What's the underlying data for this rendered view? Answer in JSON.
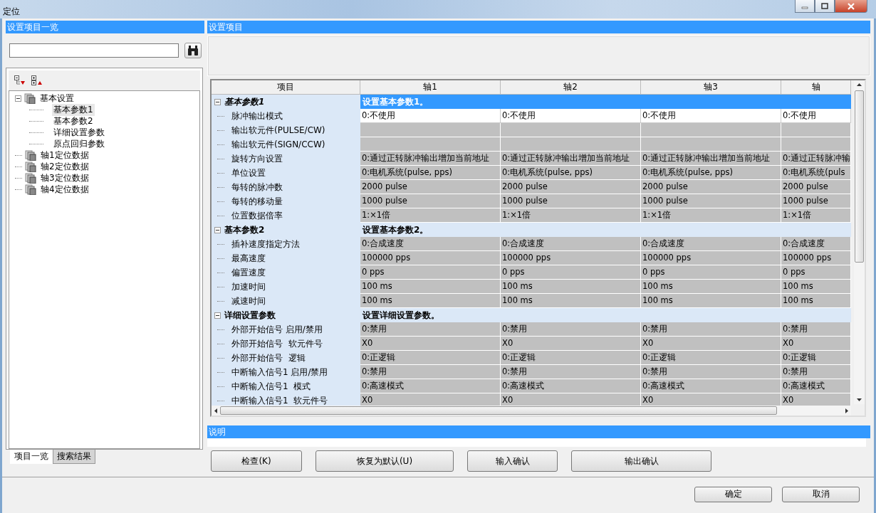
{
  "window": {
    "title": "定位"
  },
  "left_panel": {
    "title": "设置项目一览",
    "tree": [
      {
        "label": "基本设置",
        "expanded": true,
        "selected": false,
        "children": [
          {
            "label": "基本参数1",
            "selected": true
          },
          {
            "label": "基本参数2",
            "selected": false
          },
          {
            "label": "详细设置参数",
            "selected": false
          },
          {
            "label": "原点回归参数",
            "selected": false
          }
        ]
      },
      {
        "label": "轴1定位数据",
        "selected": false
      },
      {
        "label": "轴2定位数据",
        "selected": false
      },
      {
        "label": "轴3定位数据",
        "selected": false
      },
      {
        "label": "轴4定位数据",
        "selected": false
      }
    ],
    "tabs": [
      {
        "label": "项目一览",
        "selected": true
      },
      {
        "label": "搜索结果",
        "selected": false
      }
    ]
  },
  "right_panel": {
    "title": "设置项目",
    "table": {
      "columns": [
        "项目",
        "轴1",
        "轴2",
        "轴3",
        "轴"
      ],
      "groups": [
        {
          "label": "基本参数1",
          "description": "设置基本参数1。",
          "expanded": true,
          "selected": true,
          "rows": [
            {
              "label": "脉冲输出模式",
              "editable": true,
              "values": [
                "0:不使用",
                "0:不使用",
                "0:不使用",
                "0:不使用"
              ]
            },
            {
              "label": "输出软元件(PULSE/CW)",
              "editable": false,
              "values": []
            },
            {
              "label": "输出软元件(SIGN/CCW)",
              "editable": false,
              "values": []
            },
            {
              "label": "旋转方向设置",
              "editable": false,
              "values": [
                "0:通过正转脉冲输出增加当前地址",
                "0:通过正转脉冲输出增加当前地址",
                "0:通过正转脉冲输出增加当前地址",
                "0:通过正转脉冲输"
              ]
            },
            {
              "label": "单位设置",
              "editable": false,
              "values": [
                "0:电机系统(pulse, pps)",
                "0:电机系统(pulse, pps)",
                "0:电机系统(pulse, pps)",
                "0:电机系统(puls"
              ]
            },
            {
              "label": "每转的脉冲数",
              "editable": false,
              "values": [
                "2000 pulse",
                "2000 pulse",
                "2000 pulse",
                "2000 pulse"
              ]
            },
            {
              "label": "每转的移动量",
              "editable": false,
              "values": [
                "1000 pulse",
                "1000 pulse",
                "1000 pulse",
                "1000 pulse"
              ]
            },
            {
              "label": "位置数据倍率",
              "editable": false,
              "values": [
                "1:×1倍",
                "1:×1倍",
                "1:×1倍",
                "1:×1倍"
              ]
            }
          ]
        },
        {
          "label": "基本参数2",
          "description": "设置基本参数2。",
          "expanded": true,
          "selected": false,
          "rows": [
            {
              "label": "插补速度指定方法",
              "editable": false,
              "values": [
                "0:合成速度",
                "0:合成速度",
                "0:合成速度",
                "0:合成速度"
              ]
            },
            {
              "label": "最高速度",
              "editable": false,
              "values": [
                "100000 pps",
                "100000 pps",
                "100000 pps",
                "100000 pps"
              ]
            },
            {
              "label": "偏置速度",
              "editable": false,
              "values": [
                "0 pps",
                "0 pps",
                "0 pps",
                "0 pps"
              ]
            },
            {
              "label": "加速时间",
              "editable": false,
              "values": [
                "100 ms",
                "100 ms",
                "100 ms",
                "100 ms"
              ]
            },
            {
              "label": "减速时间",
              "editable": false,
              "values": [
                "100 ms",
                "100 ms",
                "100 ms",
                "100 ms"
              ]
            }
          ]
        },
        {
          "label": "详细设置参数",
          "description": "设置详细设置参数。",
          "expanded": true,
          "selected": false,
          "rows": [
            {
              "label": "外部开始信号 启用/禁用",
              "editable": false,
              "values": [
                "0:禁用",
                "0:禁用",
                "0:禁用",
                "0:禁用"
              ]
            },
            {
              "label": "外部开始信号  软元件号",
              "editable": false,
              "values": [
                "X0",
                "X0",
                "X0",
                "X0"
              ]
            },
            {
              "label": "外部开始信号  逻辑",
              "editable": false,
              "values": [
                "0:正逻辑",
                "0:正逻辑",
                "0:正逻辑",
                "0:正逻辑"
              ]
            },
            {
              "label": "中断输入信号1 启用/禁用",
              "editable": false,
              "values": [
                "0:禁用",
                "0:禁用",
                "0:禁用",
                "0:禁用"
              ]
            },
            {
              "label": "中断输入信号1  模式",
              "editable": false,
              "values": [
                "0:高速模式",
                "0:高速模式",
                "0:高速模式",
                "0:高速模式"
              ]
            },
            {
              "label": "中断输入信号1  软元件号",
              "editable": false,
              "values": [
                "X0",
                "X0",
                "X0",
                "X0"
              ]
            }
          ]
        }
      ]
    },
    "description": {
      "title": "说明"
    },
    "buttons": [
      "检查(K)",
      "恢复为默认(U)",
      "输入确认",
      "输出确认"
    ]
  },
  "dialog_buttons": [
    "确定",
    "取消"
  ]
}
